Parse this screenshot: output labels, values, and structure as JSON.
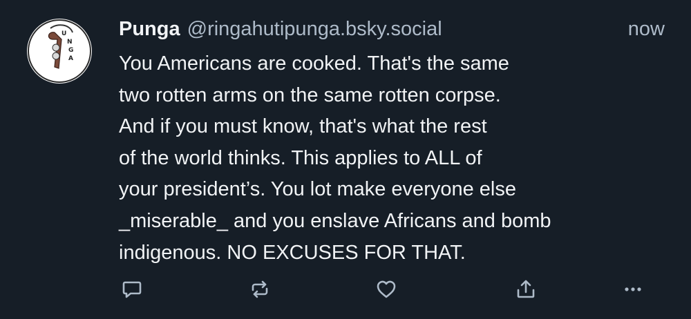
{
  "post": {
    "author": {
      "display_name": "Punga",
      "handle": "@ringahutipunga.bsky.social",
      "avatar_icon": "punga-logo-avatar",
      "avatar_text": "PUNGA"
    },
    "timestamp": "now",
    "text": "You Americans are cooked. That's the same\ntwo rotten arms on the same rotten corpse.\nAnd if you must know, that's what the rest\nof the world thinks. This applies to ALL of\nyour president’s. You lot make everyone else\n_miserable_ and you enslave Africans and bomb\nindigenous. NO EXCUSES FOR THAT.",
    "actions": [
      {
        "name": "reply",
        "icon": "speech-bubble-icon"
      },
      {
        "name": "repost",
        "icon": "repost-arrows-icon"
      },
      {
        "name": "like",
        "icon": "heart-icon"
      },
      {
        "name": "share",
        "icon": "share-upload-icon"
      },
      {
        "name": "more",
        "icon": "ellipsis-icon"
      }
    ]
  },
  "colors": {
    "background": "#161e27",
    "text_primary": "#f1f3f5",
    "text_secondary": "#aebbc9",
    "icon": "#aebbc9"
  }
}
